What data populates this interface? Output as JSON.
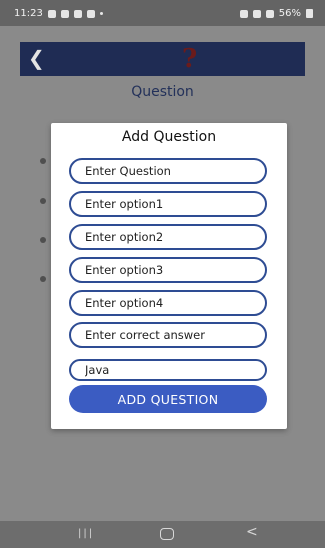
{
  "status_bar": {
    "time": "11:23",
    "battery_text": "56%"
  },
  "app_bar": {
    "back_icon": "back-arrow-icon",
    "logo_text": "?"
  },
  "background": {
    "title": "Question"
  },
  "dialog": {
    "title": "Add Question",
    "fields": {
      "question_placeholder": "Enter Question",
      "option1_placeholder": "Enter option1",
      "option2_placeholder": "Enter option2",
      "option3_placeholder": "Enter option3",
      "option4_placeholder": "Enter option4",
      "correct_answer_placeholder": "Enter correct answer",
      "category_value": "Java"
    },
    "submit_label": "ADD QUESTION"
  },
  "nav_bar": {
    "recent_label": "|||",
    "back_label": "<"
  },
  "colors": {
    "accent": "#3b5cc2",
    "field_border": "#2e4c93",
    "app_bar": "#1f2c54",
    "scrim": "#8a8a8a"
  }
}
